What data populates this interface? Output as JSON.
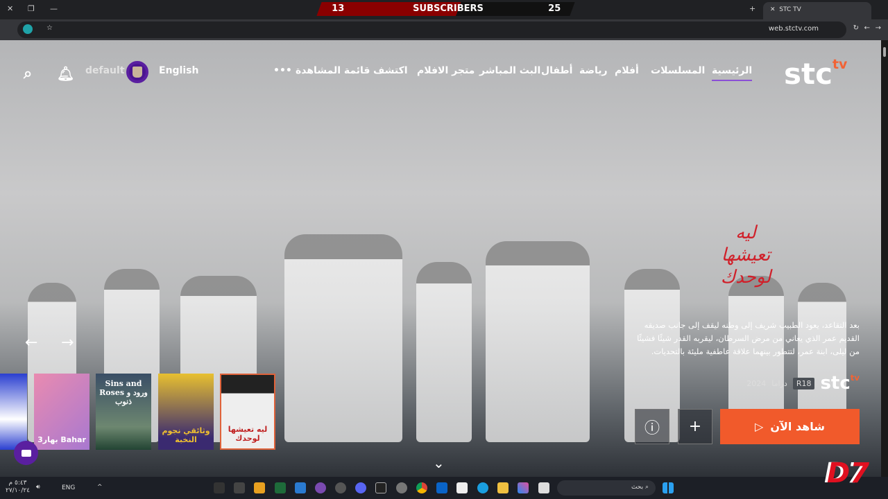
{
  "browser": {
    "tab_title": "STC TV",
    "url": "web.stctv.com",
    "overlay": {
      "left": "13",
      "label": "SUBSCRIBERS",
      "right": "25"
    }
  },
  "nav": {
    "items": [
      "الرئيسية",
      "المسلسلات",
      "أفلام",
      "رياضة",
      "أطفال",
      "البث المباشر",
      "متجر الافلام",
      "اكتشف",
      "قائمة المشاهدة"
    ],
    "more": "•••",
    "language": "English",
    "profile": "default"
  },
  "logo": {
    "main": "stc",
    "sup": "tv"
  },
  "hero": {
    "title_art": "ليه تعيشها لوحدك",
    "description": "بعد التقاعد، يعود الطبيب شريف إلى وطنه ليقف إلى جانب صديقه القديم عمر الذي يعاني من مرض السرطان، ليقربه القدر شيئًا فشيئًا من ليلى، ابنة عمر، لتتطور بينهما علاقة عاطفية مليئة بالتحديات.",
    "year": "2024",
    "genre": "دراما",
    "rating": "R18",
    "watch_label": "شاهد الآن",
    "accent": "#f15a2b"
  },
  "thumbnails": [
    {
      "title": ""
    },
    {
      "title": "بهار3 Bahar"
    },
    {
      "title": "Sins and Roses ورود و ذنوب"
    },
    {
      "title": "وثائقي نجوم النخبة"
    },
    {
      "title": "ليه تعيشها لوحدك"
    }
  ],
  "taskbar": {
    "time": "٥:٤٣ م",
    "date": "٢٧/١٠/٢٤",
    "lang": "ENG",
    "search_placeholder": "بحث"
  }
}
